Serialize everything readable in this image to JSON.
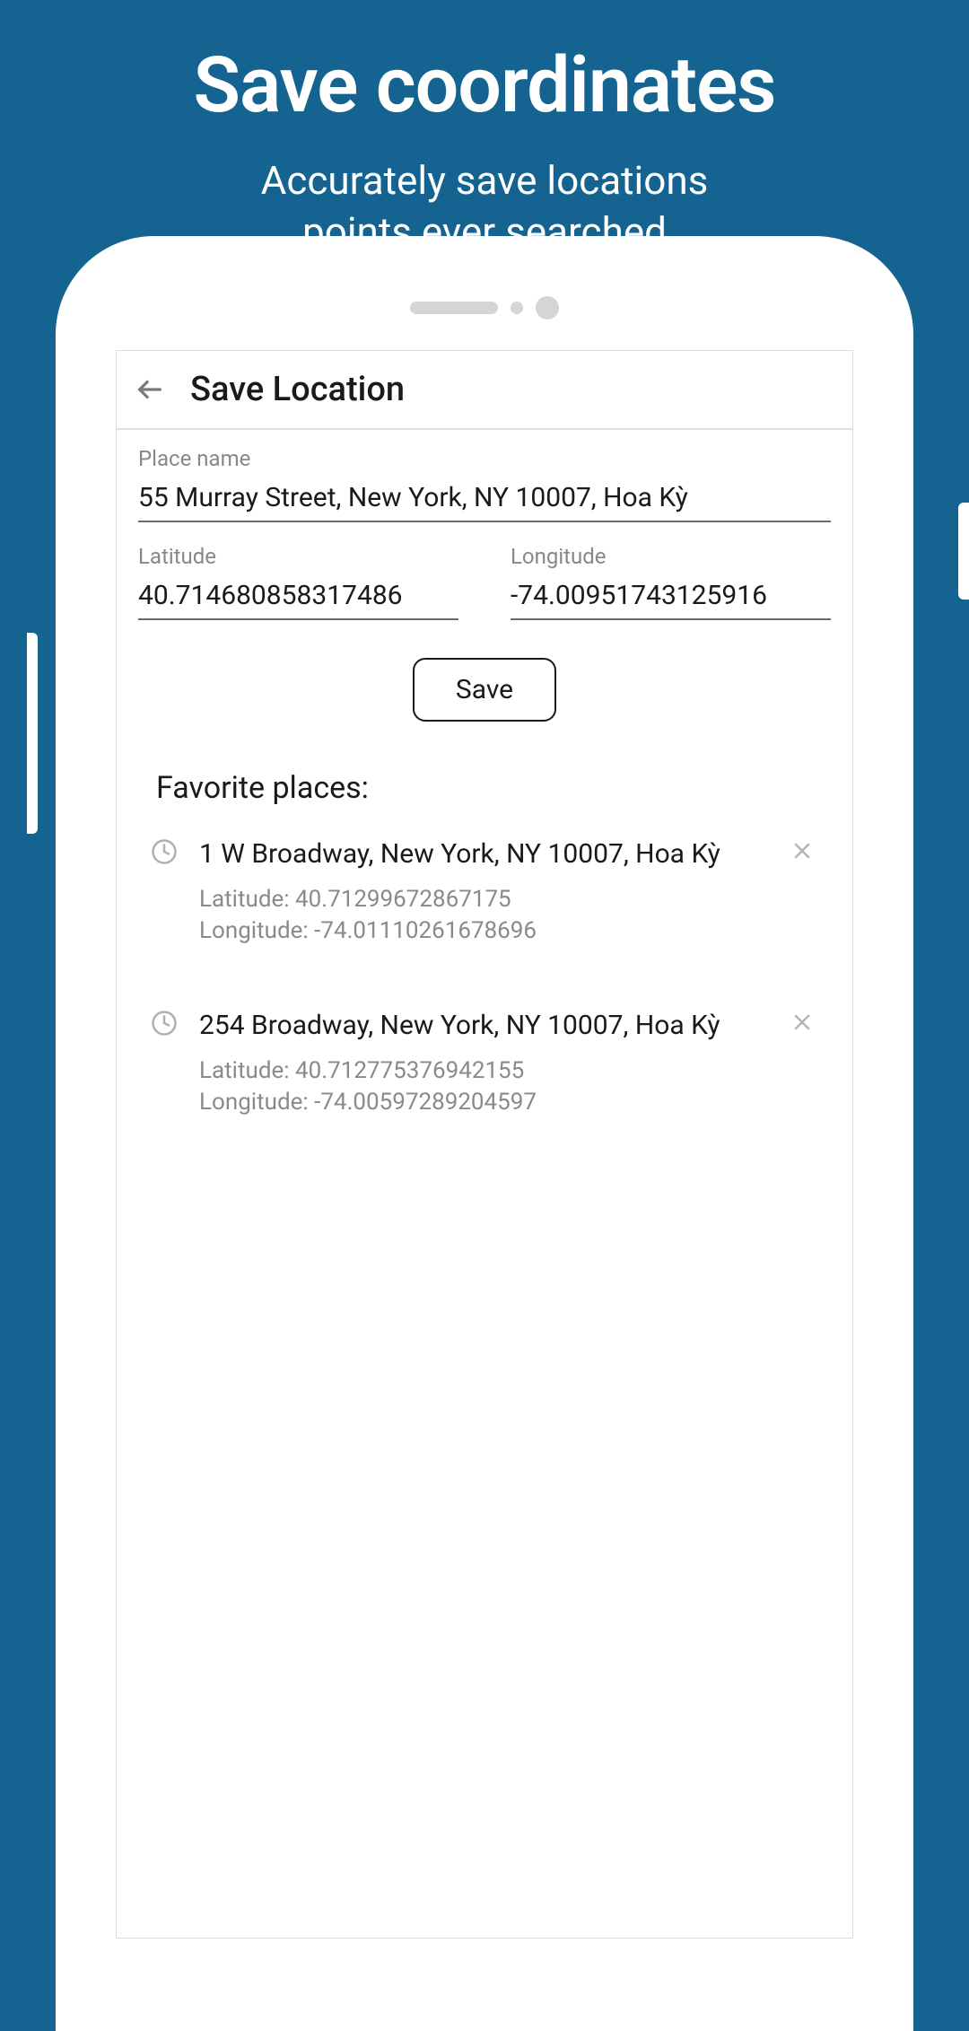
{
  "promo": {
    "title": "Save coordinates",
    "subtitle_line1": "Accurately save locations",
    "subtitle_line2": "points ever searched"
  },
  "app": {
    "header_title": "Save Location",
    "form": {
      "place_name_label": "Place name",
      "place_name_value": "55 Murray Street, New York, NY 10007, Hoa Kỳ",
      "latitude_label": "Latitude",
      "latitude_value": "40.714680858317486",
      "longitude_label": "Longitude",
      "longitude_value": "-74.00951743125916",
      "save_button_label": "Save"
    },
    "favorites": {
      "heading": "Favorite places:",
      "latitude_prefix": "Latitude: ",
      "longitude_prefix": "Longitude: ",
      "items": [
        {
          "name": "1 W Broadway, New York, NY 10007, Hoa Kỳ",
          "latitude": "40.71299672867175",
          "longitude": "-74.01110261678696"
        },
        {
          "name": "254 Broadway, New York, NY 10007, Hoa Kỳ",
          "latitude": "40.712775376942155",
          "longitude": "-74.00597289204597"
        }
      ]
    }
  }
}
